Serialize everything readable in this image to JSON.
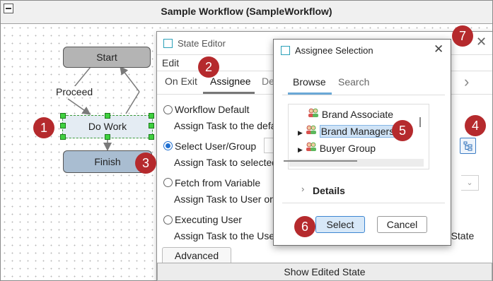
{
  "window": {
    "title": "Sample Workflow (SampleWorkflow)"
  },
  "canvas": {
    "nodes": {
      "start": "Start",
      "do_work": "Do Work",
      "finish": "Finish"
    },
    "transition_label": "Proceed"
  },
  "badges": [
    "1",
    "2",
    "3",
    "4",
    "5",
    "6",
    "7"
  ],
  "state_editor": {
    "title": "State Editor",
    "menu": {
      "edit": "Edit"
    },
    "tabs": {
      "on_exit": "On Exit",
      "assignee": "Assignee",
      "partial": "De"
    },
    "options": [
      {
        "label": "Workflow Default",
        "desc": "Assign Task to the defa",
        "selected": false
      },
      {
        "label": "Select User/Group",
        "desc": "Assign Task to selected",
        "selected": true
      },
      {
        "label": "Fetch from Variable",
        "desc": "Assign Task to User or G",
        "selected": false
      },
      {
        "label": "Executing User",
        "desc": "Assign Task to the User",
        "selected": false
      }
    ],
    "trailing_text": "nt State",
    "advanced_label": "Advanced",
    "show_edited_state_label": "Show Edited State"
  },
  "assignee_dialog": {
    "title": "Assignee Selection",
    "tabs": {
      "browse": "Browse",
      "search": "Search"
    },
    "tree": [
      {
        "label": "Brand Associate",
        "expandable": false,
        "selected": false
      },
      {
        "label": "Brand Managers",
        "expandable": true,
        "selected": true
      },
      {
        "label": "Buyer Group",
        "expandable": true,
        "selected": false
      }
    ],
    "details_label": "Details",
    "buttons": {
      "select": "Select",
      "cancel": "Cancel"
    }
  },
  "colors": {
    "badge": "#b52a2d",
    "selection_handle": "#3fd13f",
    "accent_blue": "#1f6fd1",
    "start_node": "#b4b4b4",
    "finish_node": "#a9bdd1"
  },
  "icons": {
    "dialog": "window-icon",
    "group": "group-icon",
    "picker": "tree-picker-icon",
    "close": "close-icon",
    "chevron": "chevron-right-icon"
  }
}
